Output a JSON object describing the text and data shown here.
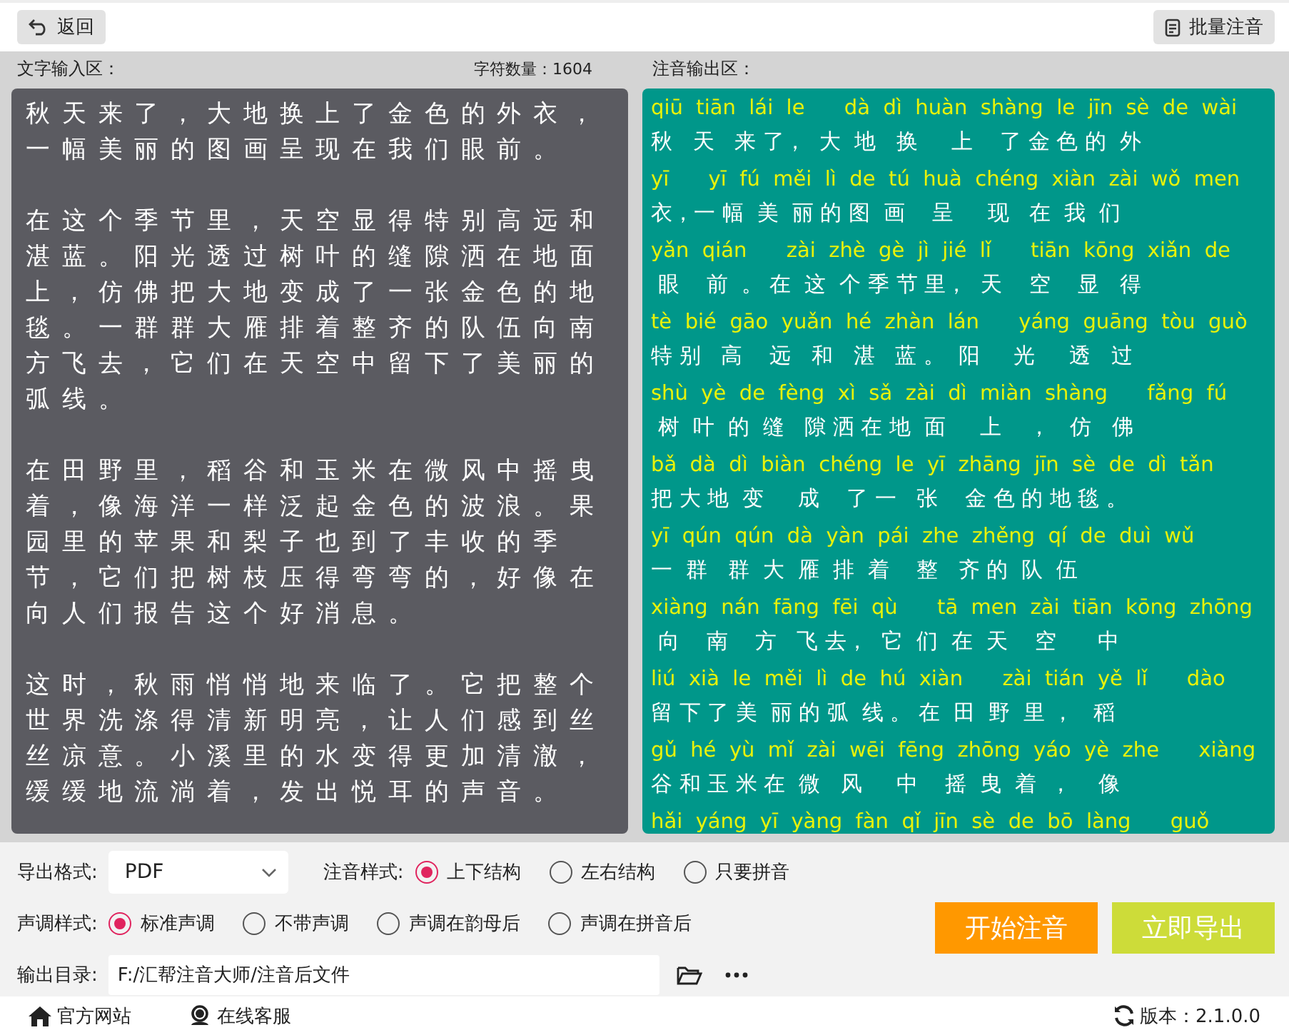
{
  "toolbar": {
    "back": "返回",
    "batch": "批量注音"
  },
  "labels": {
    "input": "文字输入区：",
    "count": "字符数量：1604",
    "output": "注音输出区："
  },
  "input_paragraphs": [
    "秋天来了，大地换上了金色的外衣，一幅美丽的图画呈现在我们眼前。",
    "在这个季节里，天空显得特别高远和湛蓝。阳光透过树叶的缝隙洒在地面上，仿佛把大地变成了一张金色的地毯。一群群大雁排着整齐的队伍向南方飞去，它们在天空中留下了美丽的弧线。",
    "在田野里，稻谷和玉米在微风中摇曳着，像海洋一样泛起金色的波浪。果园里的苹果和梨子也到了丰收的季节，它们把树枝压得弯弯的，好像在向人们报告这个好消息。",
    "这时，秋雨悄悄地来临了。它把整个世界洗涤得清新明亮，让人们感到丝丝凉意。小溪里的水变得更加清澈，缓缓地流淌着，发出悦耳的声音。"
  ],
  "output_rows": [
    {
      "pinyin": "qiū  tiān  lái  le      dà  dì  huàn  shàng  le  jīn  sè  de  wài",
      "hanzi": "秋   天   来 了，  大  地   换     上    了 金 色 的  外"
    },
    {
      "pinyin": "yī      yī  fú  měi  lì  de  tú  huà  chéng  xiàn  zài  wǒ  men",
      "hanzi": "衣，一 幅  美  丽 的 图  画    呈     现   在  我  们"
    },
    {
      "pinyin": "yǎn  qián      zài  zhè  gè  jì  jié  lǐ      tiān  kōng  xiǎn  de",
      "hanzi": " 眼    前  。 在  这  个 季 节 里，  天    空    显   得"
    },
    {
      "pinyin": "tè  bié  gāo  yuǎn  hé  zhàn  lán      yáng  guāng  tòu  guò",
      "hanzi": "特 别   高    远   和   湛   蓝 。  阳     光     透   过"
    },
    {
      "pinyin": "shù  yè  de  fèng  xì  sǎ  zài  dì  miàn  shàng      fǎng  fú",
      "hanzi": " 树  叶  的  缝   隙 洒 在 地  面     上    ，   仿   佛"
    },
    {
      "pinyin": "bǎ  dà  dì  biàn  chéng  le  yī  zhāng  jīn  sè  de  dì  tǎn",
      "hanzi": "把 大 地  变     成    了 一   张    金 色 的 地 毯 。"
    },
    {
      "pinyin": "yī  qún  qún  dà  yàn  pái  zhe  zhěng  qí  de  duì  wǔ",
      "hanzi": "一  群   群  大  雁  排  着    整   齐 的  队  伍"
    },
    {
      "pinyin": "xiàng  nán  fāng  fēi  qù      tā  men  zài  tiān  kōng  zhōng",
      "hanzi": " 向    南    方   飞 去，  它  们  在  天    空      中"
    },
    {
      "pinyin": "liú  xià  le  měi  lì  de  hú  xiàn      zài  tián  yě  lǐ      dào",
      "hanzi": "留 下 了 美  丽 的 弧  线 。 在  田  野  里 ，   稻"
    },
    {
      "pinyin": "gǔ  hé  yù  mǐ  zài  wēi  fēng  zhōng  yáo  yè  zhe      xiàng",
      "hanzi": "谷 和 玉 米 在  微   风     中    摇  曳  着  ，    像"
    },
    {
      "pinyin": "hǎi  yáng  yī  yàng  fàn  qǐ  jīn  sè  de  bō  làng      guǒ"
    }
  ],
  "export_format": {
    "label": "导出格式:",
    "value": "PDF"
  },
  "annotation_style": {
    "label": "注音样式:",
    "options": [
      {
        "label": "上下结构",
        "selected": true
      },
      {
        "label": "左右结构",
        "selected": false
      },
      {
        "label": "只要拼音",
        "selected": false
      }
    ]
  },
  "tone_style": {
    "label": "声调样式:",
    "options": [
      {
        "label": "标准声调",
        "selected": true
      },
      {
        "label": "不带声调",
        "selected": false
      },
      {
        "label": "声调在韵母后",
        "selected": false
      },
      {
        "label": "声调在拼音后",
        "selected": false
      }
    ]
  },
  "output_dir": {
    "label": "输出目录:",
    "value": "F:/汇帮注音大师/注音后文件"
  },
  "actions": {
    "start": "开始注音",
    "export": "立即导出"
  },
  "status_bar": {
    "website": "官方网站",
    "support": "在线客服",
    "version": "版本：2.1.0.0"
  }
}
